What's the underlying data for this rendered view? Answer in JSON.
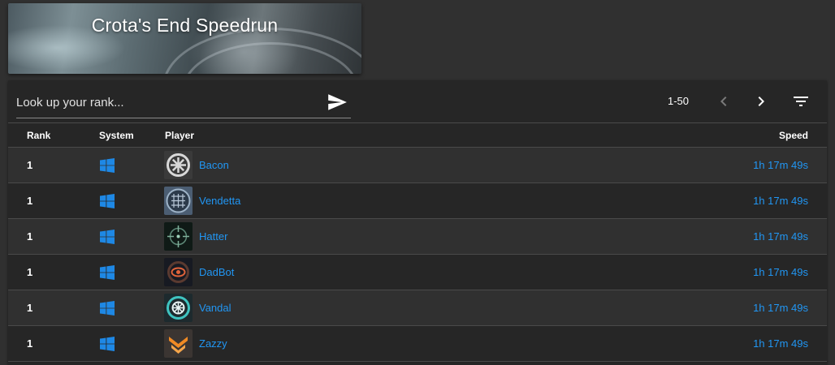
{
  "banner": {
    "title": "Crota's End Speedrun"
  },
  "toolbar": {
    "search_placeholder": "Look up your rank...",
    "send_icon": "send-icon",
    "range": "1-50",
    "prev_icon": "chevron-left-icon",
    "next_icon": "chevron-right-icon",
    "filter_icon": "filter-list-icon"
  },
  "table": {
    "headers": {
      "rank": "Rank",
      "system": "System",
      "player": "Player",
      "speed": "Speed"
    },
    "rows": [
      {
        "rank": "1",
        "system": "windows-icon",
        "player": "Bacon",
        "avatar": "emblem-white-star",
        "speed": "1h 17m 49s"
      },
      {
        "rank": "1",
        "system": "windows-icon",
        "player": "Vendetta",
        "avatar": "emblem-blue-grid",
        "speed": "1h 17m 49s"
      },
      {
        "rank": "1",
        "system": "windows-icon",
        "player": "Hatter",
        "avatar": "emblem-green-reticle",
        "speed": "1h 17m 49s"
      },
      {
        "rank": "1",
        "system": "windows-icon",
        "player": "DadBot",
        "avatar": "emblem-orange-eye",
        "speed": "1h 17m 49s"
      },
      {
        "rank": "1",
        "system": "windows-icon",
        "player": "Vandal",
        "avatar": "emblem-teal-gear",
        "speed": "1h 17m 49s"
      },
      {
        "rank": "1",
        "system": "windows-icon",
        "player": "Zazzy",
        "avatar": "emblem-orange-chevron",
        "speed": "1h 17m 49s"
      }
    ]
  },
  "colors": {
    "background": "#303030",
    "card": "#262626",
    "link": "#2196f3",
    "windows": "#1e88e5"
  }
}
